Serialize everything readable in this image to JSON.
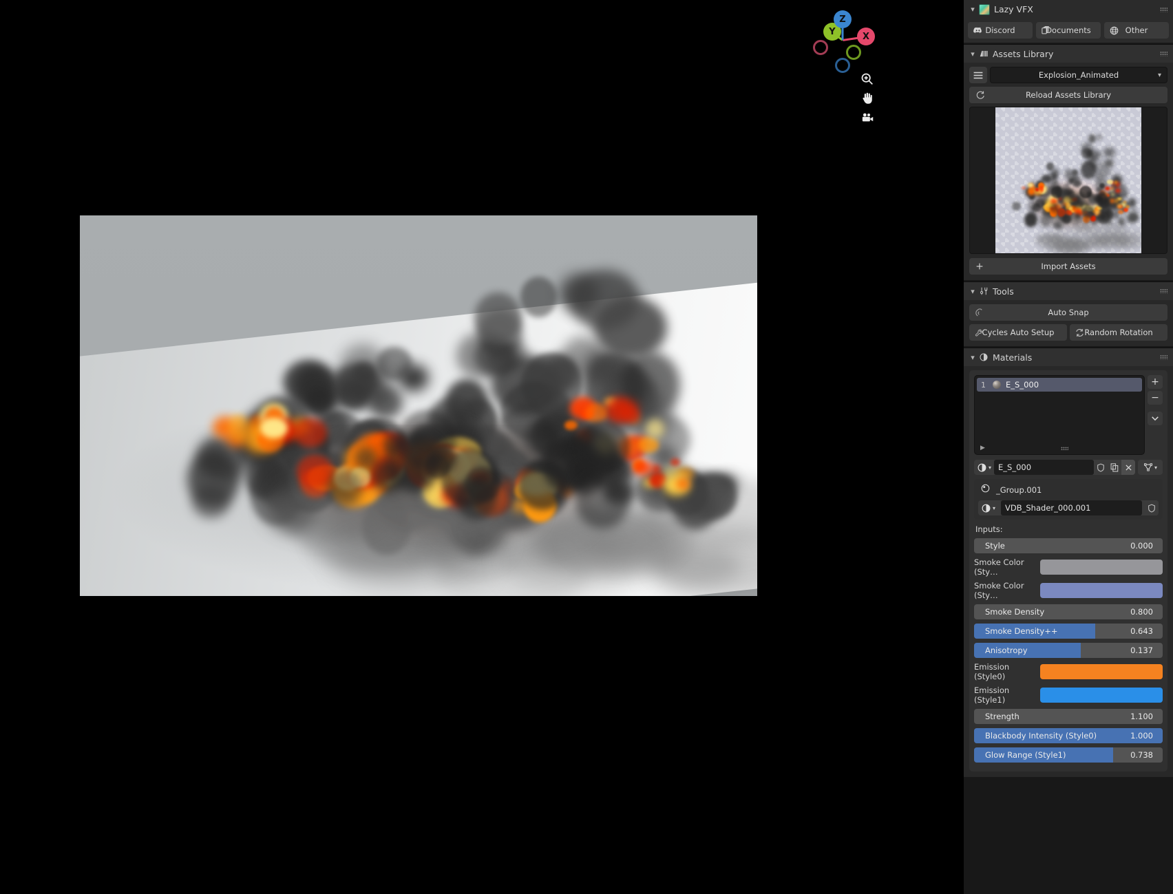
{
  "addon": {
    "title": "Lazy VFX",
    "icon": "addon-logo-icon",
    "collapse_icon": "chevron-down-icon",
    "grip_icon": "grip-dots-icon",
    "tabs": [
      {
        "label": "Discord",
        "icon": "discord-icon"
      },
      {
        "label": "Documents",
        "icon": "documents-icon"
      },
      {
        "label": "Other",
        "icon": "globe-icon"
      }
    ]
  },
  "assets_library": {
    "title": "Assets Library",
    "icon": "library-bars-icon",
    "menu_icon": "hamburger-menu-icon",
    "selected_asset": "Explosion_Animated",
    "dropdown_icon": "chevron-down-icon",
    "reload_label": "Reload Assets Library",
    "reload_icon": "refresh-icon",
    "preview_name": "explosion-asset-thumbnail",
    "import_label": "Import Assets",
    "import_icon": "plus-icon"
  },
  "tools": {
    "title": "Tools",
    "icon": "tools-wrench-icon",
    "auto_snap_label": "Auto Snap",
    "auto_snap_icon": "magnet-icon",
    "cycles_label": "Cycles Auto Setup",
    "cycles_icon": "wrench-icon",
    "random_rotation_label": "Random Rotation",
    "random_rotation_icon": "refresh-icon"
  },
  "materials": {
    "title": "Materials",
    "icon": "material-sphere-icon",
    "slots": [
      {
        "index": "1",
        "name": "E_S_000"
      }
    ],
    "add_slot_label": "+",
    "remove_slot_label": "−",
    "menu_chevron": "chevron-down-icon",
    "expand_icon": "triangle-right-icon",
    "resize_grip_icon": "grip-dots-icon",
    "active_material": "E_S_000",
    "material_browse_icon": "material-sphere-icon",
    "shield_icon": "fake-user-shield-icon",
    "copy_icon": "new-material-copy-icon",
    "close_icon": "unlink-x-icon",
    "node_icon": "node-triangle-icon",
    "node_group_name": "_Group.001",
    "node_group_icon": "node-group-sphere-icon",
    "shader_name": "VDB_Shader_000.001",
    "shader_browse_icon": "material-sphere-icon",
    "shader_shield_icon": "fake-user-shield-icon",
    "inputs_label": "Inputs:",
    "inputs": [
      {
        "type": "slider",
        "label": "Style",
        "value": "0.000",
        "fill": 0
      },
      {
        "type": "color",
        "label": "Smoke Color (Sty…",
        "color": "#96969a"
      },
      {
        "type": "color",
        "label": "Smoke Color (Sty…",
        "color": "#7b89c0"
      },
      {
        "type": "slider",
        "label": "Smoke Density",
        "value": "0.800",
        "fill": 0
      },
      {
        "type": "slider",
        "label": "Smoke Density++",
        "value": "0.643",
        "fill": 64.3
      },
      {
        "type": "slider",
        "label": "Anisotropy",
        "value": "0.137",
        "fill": 56.5
      },
      {
        "type": "color",
        "label": "Emission (Style0)",
        "color": "#f58220"
      },
      {
        "type": "color",
        "label": "Emission (Style1)",
        "color": "#2a8fe8"
      },
      {
        "type": "slider",
        "label": "Strength",
        "value": "1.100",
        "fill": 0
      },
      {
        "type": "slider",
        "label": "Blackbody Intensity  (Style0)",
        "value": "1.000",
        "fill": 100
      },
      {
        "type": "slider",
        "label": "Glow Range (Style1)",
        "value": "0.738",
        "fill": 73.8
      }
    ]
  },
  "viewport": {
    "gizmo": {
      "axes": [
        {
          "label": "X",
          "color": "#e5486b",
          "name": "gizmo-axis-x"
        },
        {
          "label": "Y",
          "color": "#8ec128",
          "name": "gizmo-axis-y"
        },
        {
          "label": "Z",
          "color": "#3b86d0",
          "name": "gizmo-axis-z"
        },
        {
          "label": "",
          "color": "#a33c54",
          "name": "gizmo-axis-neg-x"
        },
        {
          "label": "",
          "color": "#6e9920",
          "name": "gizmo-axis-neg-y"
        },
        {
          "label": "",
          "color": "#2a5f94",
          "name": "gizmo-axis-neg-z"
        }
      ]
    },
    "tools": [
      {
        "name": "zoom-icon"
      },
      {
        "name": "pan-hand-icon"
      },
      {
        "name": "camera-icon"
      }
    ],
    "render_name": "explosion-render-preview"
  }
}
